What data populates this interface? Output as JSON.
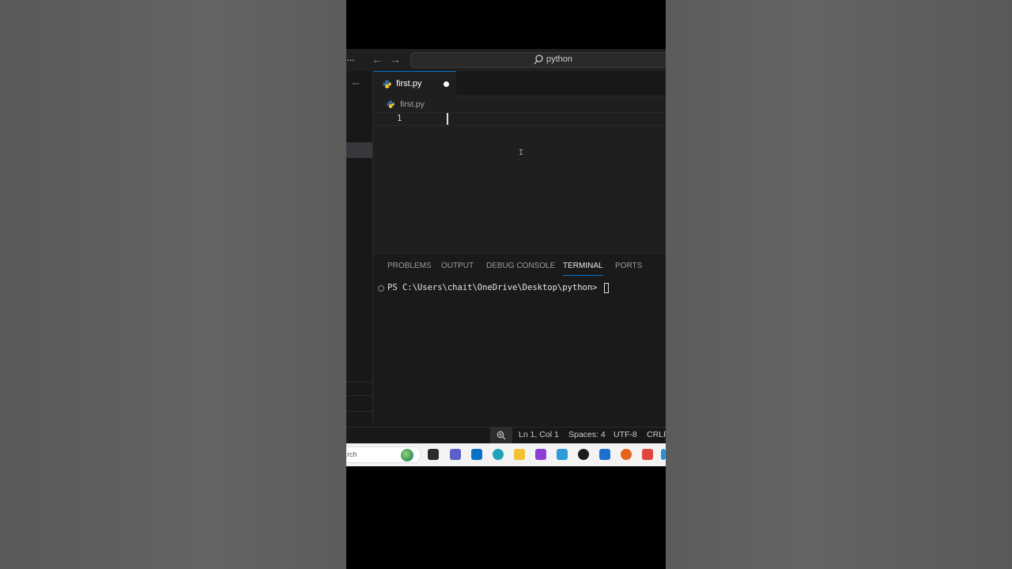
{
  "titlebar": {
    "menu_icon": "ellipsis-icon",
    "search_text": "python"
  },
  "tab": {
    "filename": "first.py",
    "modified": true
  },
  "breadcrumb": {
    "filename": "first.py"
  },
  "editor": {
    "line_number": "1"
  },
  "panel": {
    "tabs": [
      {
        "label": "PROBLEMS",
        "active": false
      },
      {
        "label": "OUTPUT",
        "active": false
      },
      {
        "label": "DEBUG CONSOLE",
        "active": false
      },
      {
        "label": "TERMINAL",
        "active": true
      },
      {
        "label": "PORTS",
        "active": false
      }
    ],
    "terminal_line": "PS C:\\Users\\chait\\OneDrive\\Desktop\\python>"
  },
  "status": {
    "position": "Ln 1, Col 1",
    "spaces": "Spaces: 4",
    "encoding": "UTF-8",
    "eol": "CRLF"
  },
  "taskbar": {
    "search_text": "rch",
    "icons": [
      "widgets-globe-icon",
      "terminal-app-icon",
      "teams-icon",
      "dell-icon",
      "edge-icon",
      "file-explorer-icon",
      "media-app-icon",
      "notepad-icon",
      "github-icon",
      "store-icon",
      "firefox-icon",
      "brave-icon",
      "vscode-icon"
    ]
  },
  "colors": {
    "accent": "#0078d4",
    "editor_bg": "#1f1f1f",
    "panel_bg": "#1a1a1a",
    "python_blue": "#3572a5",
    "python_yellow": "#ffd43b"
  }
}
